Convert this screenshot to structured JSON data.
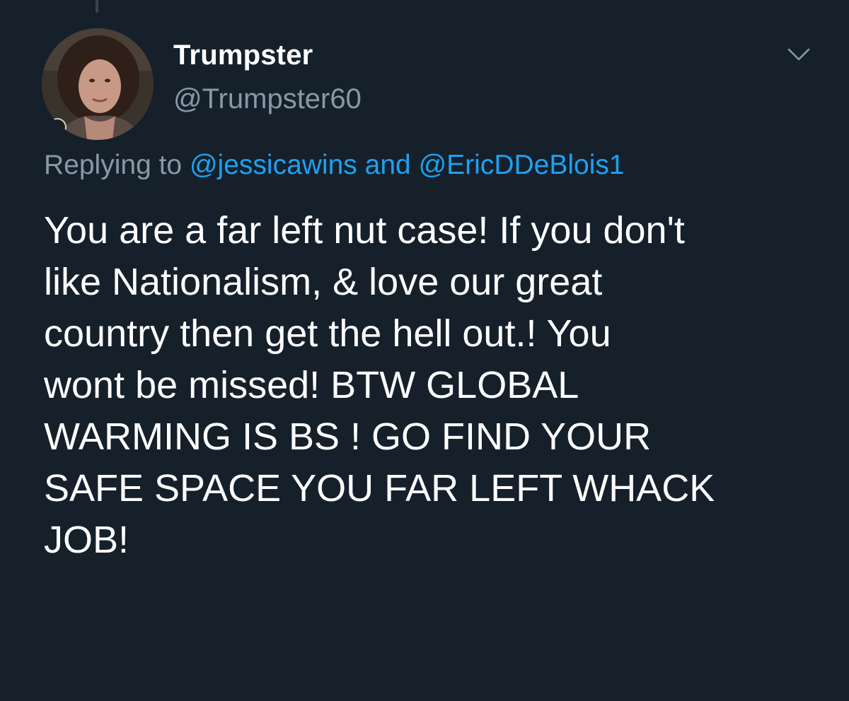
{
  "tweet": {
    "display_name": "Trumpster",
    "handle": "@Trumpster60",
    "reply": {
      "prefix": "Replying to",
      "mention_1": "@jessicawins",
      "joiner": "and",
      "mention_2": "@EricDDeBlois1"
    },
    "text_lines": [
      "You are a far left nut case! If you don't",
      "like Nationalism, & love our great",
      "country then get the hell out.! You",
      "wont be missed! BTW GLOBAL",
      "WARMING IS BS ! GO FIND YOUR",
      "SAFE SPACE YOU FAR LEFT WHACK",
      "JOB!"
    ]
  },
  "icons": {
    "menu": "chevron-down-icon",
    "avatar": "avatar-photo"
  },
  "colors": {
    "background": "#15202b",
    "primary_text": "#ffffff",
    "secondary_text": "#8899a6",
    "link": "#1da1f2"
  }
}
